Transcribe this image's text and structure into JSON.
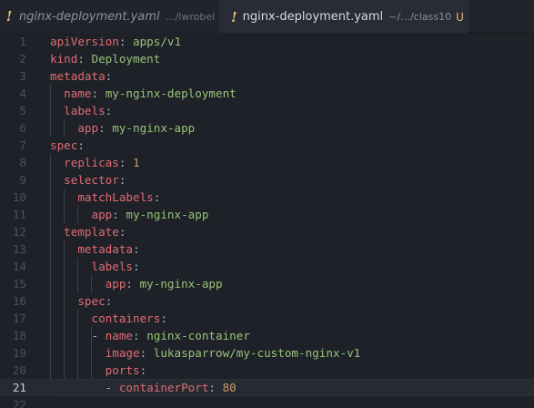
{
  "tabs": [
    {
      "icon": "!",
      "title": "nginx-deployment.yaml",
      "path": "…/lwrobel",
      "active": false
    },
    {
      "icon": "!",
      "title": "nginx-deployment.yaml",
      "path": "~/…/class10",
      "badge": "U",
      "close": "✕",
      "active": true
    }
  ],
  "editor": {
    "current_line": 21,
    "lines": [
      {
        "n": "1",
        "indent": "",
        "key": "apiVersion",
        "sep": ": ",
        "value": "apps/v1"
      },
      {
        "n": "2",
        "indent": "",
        "key": "kind",
        "sep": ": ",
        "value": "Deployment"
      },
      {
        "n": "3",
        "indent": "",
        "key": "metadata",
        "sep": ":",
        "value": ""
      },
      {
        "n": "4",
        "indent": "  ",
        "key": "name",
        "sep": ": ",
        "value": "my-nginx-deployment"
      },
      {
        "n": "5",
        "indent": "  ",
        "key": "labels",
        "sep": ":",
        "value": ""
      },
      {
        "n": "6",
        "indent": "    ",
        "key": "app",
        "sep": ": ",
        "value": "my-nginx-app"
      },
      {
        "n": "7",
        "indent": "",
        "key": "spec",
        "sep": ":",
        "value": ""
      },
      {
        "n": "8",
        "indent": "  ",
        "key": "replicas",
        "sep": ": ",
        "value": "",
        "num": "1"
      },
      {
        "n": "9",
        "indent": "  ",
        "key": "selector",
        "sep": ":",
        "value": ""
      },
      {
        "n": "10",
        "indent": "    ",
        "key": "matchLabels",
        "sep": ":",
        "value": ""
      },
      {
        "n": "11",
        "indent": "      ",
        "key": "app",
        "sep": ": ",
        "value": "my-nginx-app"
      },
      {
        "n": "12",
        "indent": "  ",
        "key": "template",
        "sep": ":",
        "value": ""
      },
      {
        "n": "13",
        "indent": "    ",
        "key": "metadata",
        "sep": ":",
        "value": ""
      },
      {
        "n": "14",
        "indent": "      ",
        "key": "labels",
        "sep": ":",
        "value": ""
      },
      {
        "n": "15",
        "indent": "        ",
        "key": "app",
        "sep": ": ",
        "value": "my-nginx-app"
      },
      {
        "n": "16",
        "indent": "    ",
        "key": "spec",
        "sep": ":",
        "value": ""
      },
      {
        "n": "17",
        "indent": "      ",
        "key": "containers",
        "sep": ":",
        "value": ""
      },
      {
        "n": "18",
        "indent": "      - ",
        "key": "name",
        "sep": ": ",
        "value": "nginx-container"
      },
      {
        "n": "19",
        "indent": "        ",
        "key": "image",
        "sep": ": ",
        "value": "lukasparrow/my-custom-nginx-v1"
      },
      {
        "n": "20",
        "indent": "        ",
        "key": "ports",
        "sep": ":",
        "value": ""
      },
      {
        "n": "21",
        "indent": "        - ",
        "key": "containerPort",
        "sep": ": ",
        "value": "",
        "num": "80"
      },
      {
        "n": "22",
        "indent": "",
        "key": "",
        "sep": "",
        "value": ""
      }
    ]
  },
  "colors": {
    "key": "#e06c75",
    "string": "#98c379",
    "number": "#d19a66",
    "warning_icon": "#e5c07b",
    "background": "#1e2127"
  }
}
